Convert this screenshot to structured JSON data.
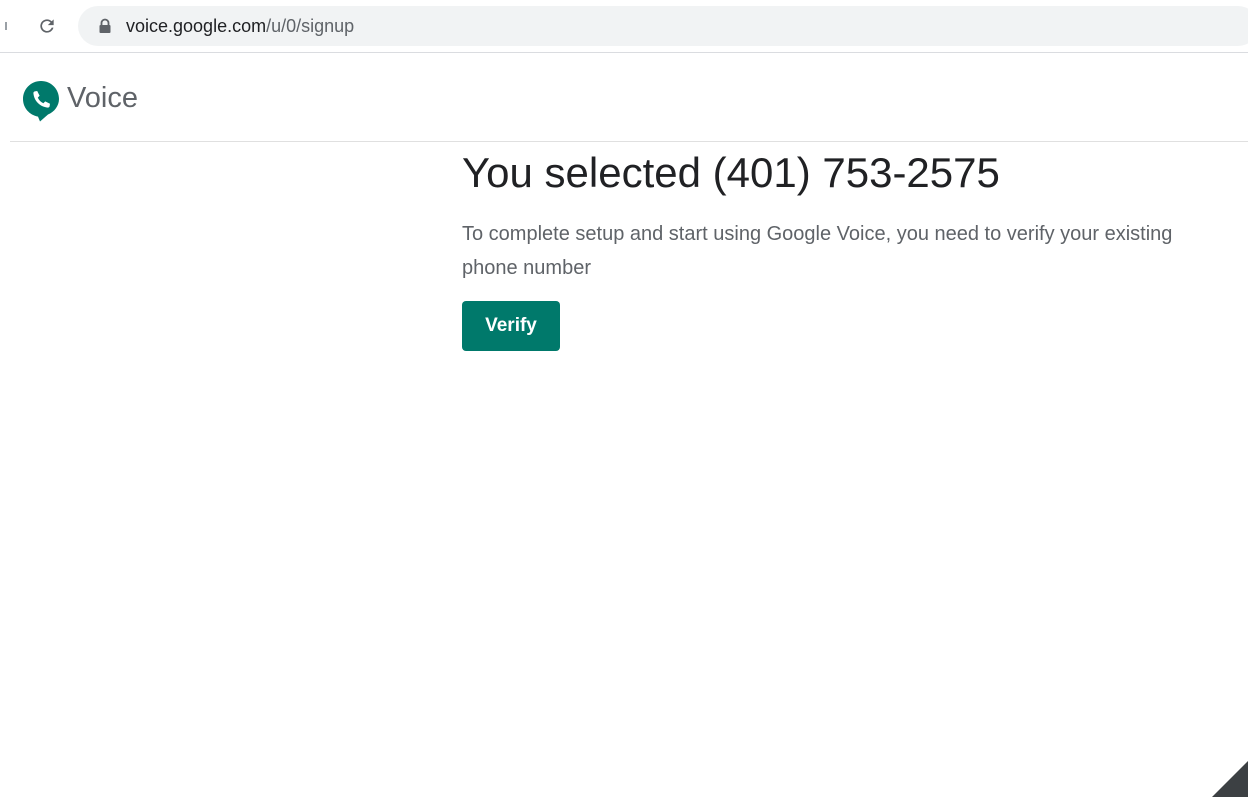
{
  "browser": {
    "url_host": "voice.google.com",
    "url_path": "/u/0/signup"
  },
  "header": {
    "product_name": "Voice",
    "logo_icon": "voice-logo-icon"
  },
  "main": {
    "title": "You selected (401) 753-2575",
    "description": "To complete setup and start using Google Voice, you need to verify your existing phone number",
    "verify_label": "Verify"
  },
  "colors": {
    "accent": "#00796b",
    "logo_green": "#00796b",
    "title_text": "#202124",
    "body_text": "#5f6368"
  }
}
